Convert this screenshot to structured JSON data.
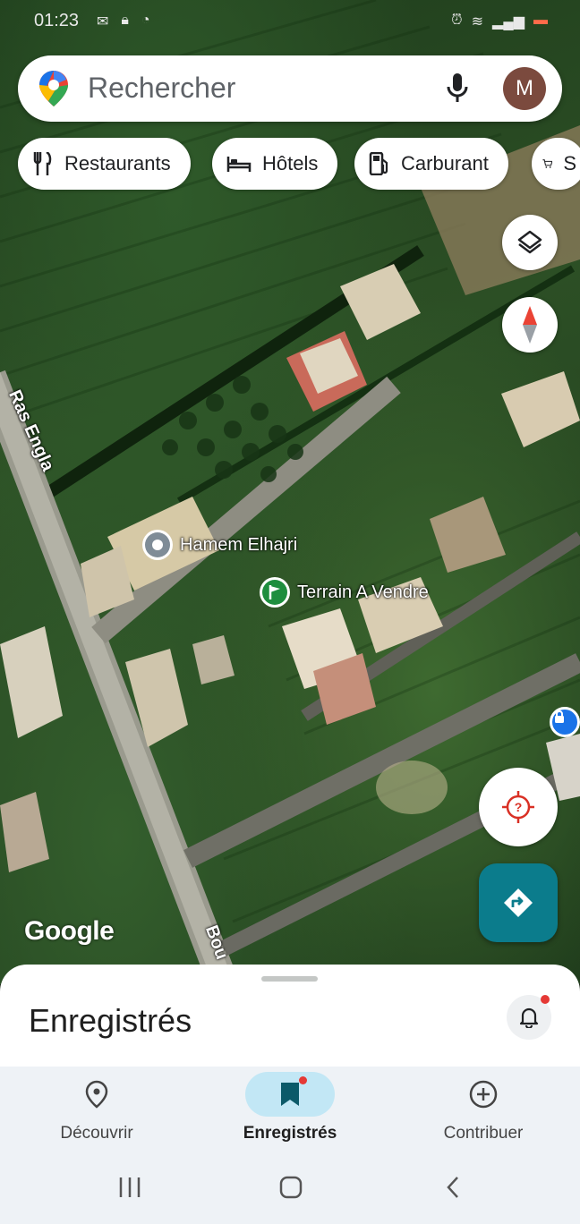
{
  "status_bar": {
    "time": "01:23",
    "left_icons": [
      "notification-icon",
      "lock-icon",
      "whatsapp-icon"
    ],
    "right_icons": [
      "alarm-icon",
      "wifi-icon",
      "signal-icon",
      "battery-icon"
    ]
  },
  "search": {
    "placeholder": "Rechercher",
    "avatar_letter": "M",
    "avatar_color": "#7b4a3e"
  },
  "chips": [
    {
      "label": "Restaurants",
      "icon": "fork-knife-icon"
    },
    {
      "label": "Hôtels",
      "icon": "bed-icon"
    },
    {
      "label": "Carburant",
      "icon": "fuel-icon"
    },
    {
      "label": "S",
      "icon": "cart-icon"
    }
  ],
  "map": {
    "places": [
      {
        "name": "Hamem Elhajri",
        "icon": "place-pin-icon"
      },
      {
        "name": "Terrain A Vendre",
        "icon": "flag-icon"
      }
    ],
    "roads": [
      "Ras Engla",
      "Bou"
    ],
    "attribution": "Google",
    "accent_color": "#0b7c8c"
  },
  "sheet": {
    "title": "Enregistrés"
  },
  "bottom_nav": {
    "items": [
      {
        "label": "Découvrir",
        "icon": "location-pin-icon",
        "active": false
      },
      {
        "label": "Enregistrés",
        "icon": "bookmark-icon",
        "active": true
      },
      {
        "label": "Contribuer",
        "icon": "add-circle-icon",
        "active": false
      }
    ]
  }
}
